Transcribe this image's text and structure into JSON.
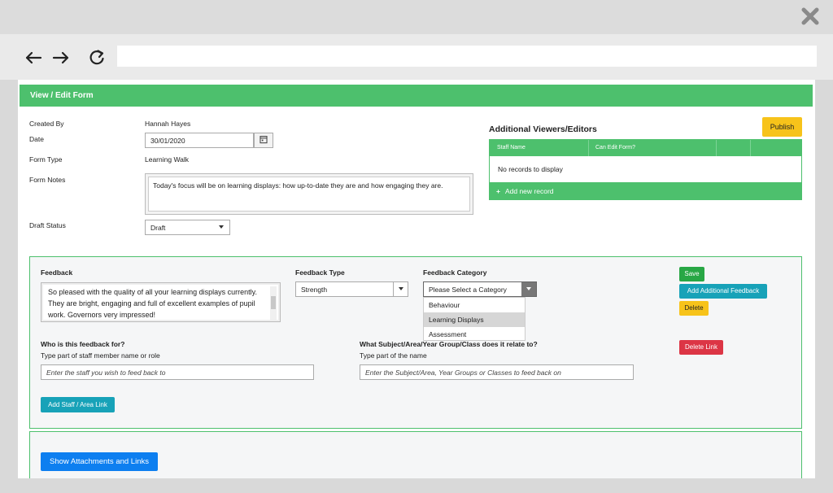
{
  "window": {
    "close_icon": "close-x-icon",
    "nav": {
      "back_icon": "arrow-left-icon",
      "forward_icon": "arrow-right-icon",
      "reload_icon": "reload-icon"
    },
    "url": ""
  },
  "form": {
    "header_title": "View / Edit Form",
    "created_by_label": "Created By",
    "created_by_value": "Hannah Hayes",
    "date_label": "Date",
    "date_value": "30/01/2020",
    "form_type_label": "Form Type",
    "form_type_value": "Learning Walk",
    "form_notes_label": "Form Notes",
    "form_notes_value": "Today's focus will be on learning displays: how up-to-date they are and how engaging they are.",
    "draft_status_label": "Draft Status",
    "draft_status_value": "Draft"
  },
  "viewers": {
    "title": "Additional Viewers/Editors",
    "publish_label": "Publish",
    "columns": [
      "Staff Name",
      "Can Edit Form?"
    ],
    "empty_text": "No records to display",
    "add_record_label": "Add new record",
    "add_record_icon": "plus-icon"
  },
  "feedback": {
    "feedback_label": "Feedback",
    "feedback_text": "So pleased with the quality of all your learning displays currently. They are bright, engaging and full of excellent examples of pupil work. Governors very impressed!",
    "type_label": "Feedback Type",
    "type_value": "Strength",
    "category_label": "Feedback Category",
    "category_value": "Please Select a Category",
    "category_options": [
      "Behaviour",
      "Learning Displays",
      "Assessment"
    ],
    "category_highlighted": "Learning Displays",
    "save_label": "Save",
    "add_additional_label": "Add Additional Feedback",
    "delete_label": "Delete",
    "delete_link_label": "Delete Link",
    "who_label": "Who is this feedback for?",
    "who_hint": "Type part of staff member name or role",
    "who_placeholder": "Enter the staff you wish to feed back to",
    "subject_label": "What Subject/Area/Year Group/Class does it relate to?",
    "subject_hint": "Type part of the name",
    "subject_placeholder": "Enter the Subject/Area, Year Groups or Classes to feed back on",
    "add_staff_label": "Add Staff / Area Link"
  },
  "attachments": {
    "show_label": "Show Attachments and Links"
  },
  "colors": {
    "accent_green": "#4dc06d",
    "publish_yellow": "#f7c31a",
    "info_teal": "#17a2b8",
    "danger_red": "#dc3545",
    "primary_blue": "#0d7ff0"
  }
}
